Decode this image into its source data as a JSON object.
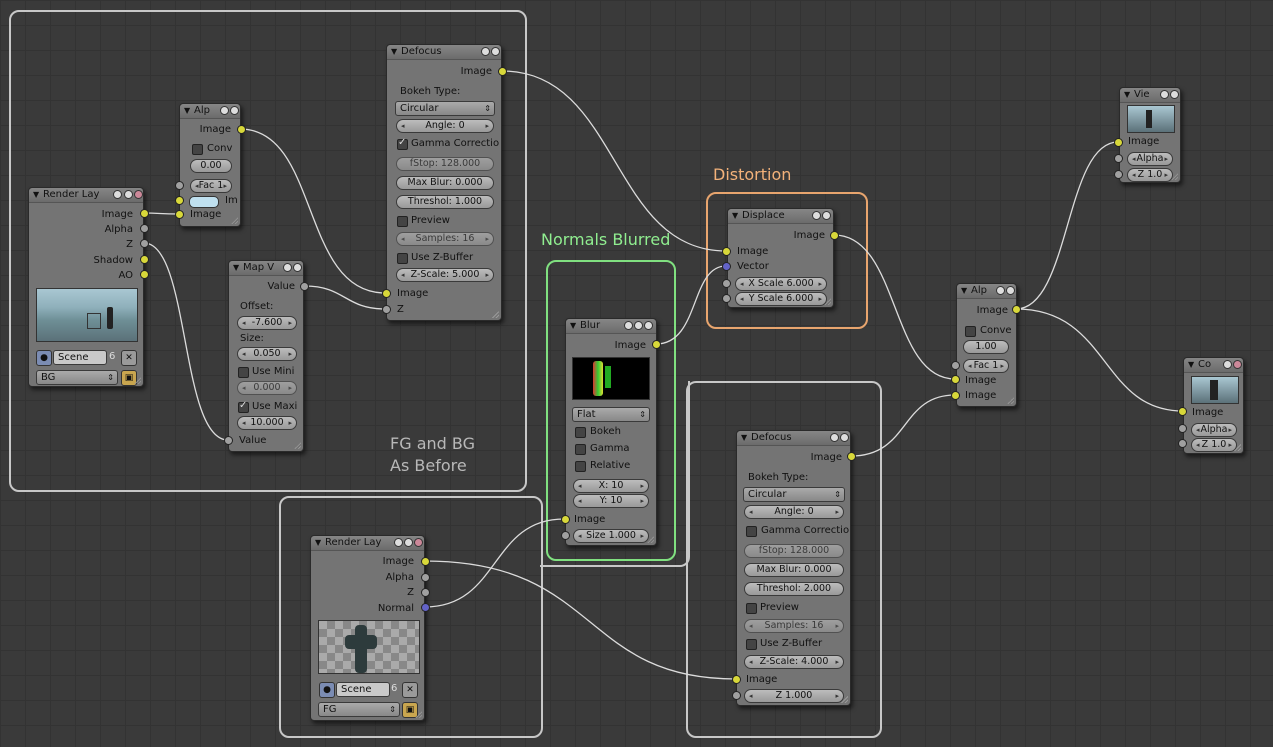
{
  "frames": {
    "fg_bg_label_line1": "FG and BG",
    "fg_bg_label_line2": "As Before",
    "normals_label": "Normals Blurred",
    "distortion_label": "Distortion"
  },
  "render_layer_bg": {
    "title": "Render Lay",
    "outputs": [
      "Image",
      "Alpha",
      "Z",
      "Shadow",
      "AO"
    ],
    "scene_label": "Scene",
    "scene_num": "6",
    "layer_value": "BG"
  },
  "alpha_over_top": {
    "title": "Alp",
    "output": "Image",
    "conv_label": "Conv",
    "value": "0.00",
    "fac": "Fac 1",
    "input_im": "Im",
    "input_image": "Image"
  },
  "map_value": {
    "title": "Map V",
    "output": "Value",
    "offset_label": "Offset:",
    "offset_value": "-7.600",
    "size_label": "Size:",
    "size_value": "0.050",
    "use_min_label": "Use Mini",
    "min_value": "0.000",
    "use_max_label": "Use Maxi",
    "max_value": "10.000",
    "input": "Value"
  },
  "defocus_top": {
    "title": "Defocus",
    "output": "Image",
    "bokeh_label": "Bokeh Type:",
    "bokeh_value": "Circular",
    "angle": "Angle: 0",
    "gamma": "Gamma Correctio",
    "fstop": "fStop: 128.000",
    "maxblur": "Max Blur: 0.000",
    "threshold": "Threshol: 1.000",
    "preview": "Preview",
    "samples": "Samples: 16",
    "use_z": "Use Z-Buffer",
    "zscale": "Z-Scale: 5.000",
    "input_image": "Image",
    "input_z": "Z"
  },
  "blur": {
    "title": "Blur",
    "output": "Image",
    "filter": "Flat",
    "bokeh": "Bokeh",
    "gamma": "Gamma",
    "relative": "Relative",
    "x": "X: 10",
    "y": "Y: 10",
    "input_image": "Image",
    "size": "Size 1.000"
  },
  "displace": {
    "title": "Displace",
    "output": "Image",
    "input_image": "Image",
    "input_vector": "Vector",
    "x_scale": "X Scale 6.000",
    "y_scale": "Y Scale 6.000"
  },
  "alpha_over_right": {
    "title": "Alp",
    "output": "Image",
    "conv_label": "Conve",
    "value": "1.00",
    "fac": "Fac 1",
    "input1": "Image",
    "input2": "Image"
  },
  "viewer": {
    "title": "Vie",
    "input_image": "Image",
    "alpha": "Alpha",
    "z": "Z 1.0"
  },
  "composite": {
    "title": "Co",
    "input_image": "Image",
    "alpha": "Alpha",
    "z": "Z 1.0"
  },
  "defocus_bottom": {
    "title": "Defocus",
    "output": "Image",
    "bokeh_label": "Bokeh Type:",
    "bokeh_value": "Circular",
    "angle": "Angle: 0",
    "gamma": "Gamma Correctio",
    "fstop": "fStop: 128.000",
    "maxblur": "Max Blur: 0.000",
    "threshold": "Threshol: 2.000",
    "preview": "Preview",
    "samples": "Samples: 16",
    "use_z": "Use Z-Buffer",
    "zscale": "Z-Scale: 4.000",
    "input_image": "Image",
    "z": "Z 1.000"
  },
  "render_layer_fg": {
    "title": "Render Lay",
    "outputs": [
      "Image",
      "Alpha",
      "Z",
      "Normal"
    ],
    "scene_label": "Scene",
    "scene_num": "6",
    "layer_value": "FG"
  },
  "colors": {
    "node_bg": "#747474",
    "socket_yellow": "#d8d83a",
    "socket_gray": "#a0a0a0",
    "socket_blue": "#6363c7",
    "frame_green": "#80e080",
    "frame_orange": "#e8a56e",
    "frame_gray": "#c8c8c8"
  }
}
